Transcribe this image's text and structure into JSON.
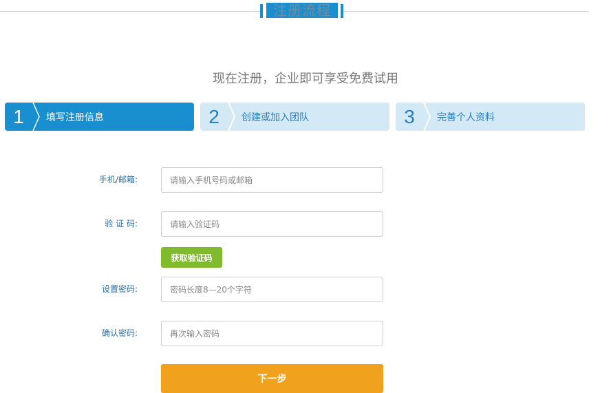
{
  "header": {
    "title": "注册流程",
    "subtitle": "现在注册，企业即可享受免费试用"
  },
  "steps": [
    {
      "num": "1",
      "label": "填写注册信息"
    },
    {
      "num": "2",
      "label": "创建或加入团队"
    },
    {
      "num": "3",
      "label": "完善个人资料"
    }
  ],
  "form": {
    "phone": {
      "label": "手机/邮箱:",
      "placeholder": "请输入手机号码或邮箱"
    },
    "code": {
      "label": "验 证 码:",
      "placeholder": "请输入验证码",
      "button": "获取验证码"
    },
    "password": {
      "label": "设置密码:",
      "placeholder": "密码长度8—20个字符"
    },
    "confirm": {
      "label": "确认密码:",
      "placeholder": "再次输入密码"
    },
    "next": "下一步"
  }
}
